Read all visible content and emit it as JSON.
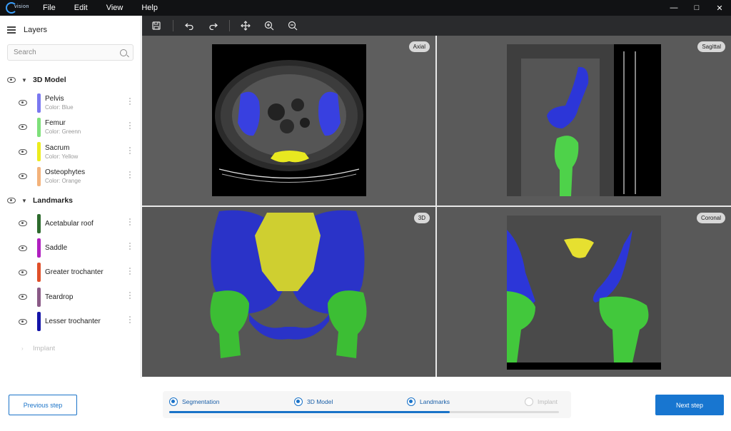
{
  "app": {
    "logo_text": "vision",
    "menu": [
      "File",
      "Edit",
      "View",
      "Help"
    ]
  },
  "sidebar": {
    "title": "Layers",
    "search_placeholder": "Search",
    "groups": [
      {
        "label": "3D Model",
        "layers": [
          {
            "name": "Pelvis",
            "sub": "Color: Blue",
            "color": "#7a78f0"
          },
          {
            "name": "Femur",
            "sub": "Color: Greenn",
            "color": "#7ee07a"
          },
          {
            "name": "Sacrum",
            "sub": "Color: Yellow",
            "color": "#ecec1e"
          },
          {
            "name": "Osteophytes",
            "sub": "Color: Orange",
            "color": "#f3b27a"
          }
        ]
      },
      {
        "label": "Landmarks",
        "layers": [
          {
            "name": "Acetabular roof",
            "color": "#2e6b2e"
          },
          {
            "name": "Saddle",
            "color": "#b01fc0"
          },
          {
            "name": "Greater trochanter",
            "color": "#e0502a"
          },
          {
            "name": "Teardrop",
            "color": "#8a5a86"
          },
          {
            "name": "Lesser trochanter",
            "color": "#1414a8"
          }
        ]
      }
    ],
    "implant_label": "Implant"
  },
  "viewports": {
    "axial": "Axial",
    "sagittal": "Sagittal",
    "three_d": "3D",
    "coronal": "Coronal"
  },
  "footer": {
    "prev_label": "Previous step",
    "next_label": "Next step",
    "steps": [
      {
        "label": "Segmentation",
        "done": true
      },
      {
        "label": "3D Model",
        "done": true
      },
      {
        "label": "Landmarks",
        "done": true
      },
      {
        "label": "Implant",
        "done": false
      }
    ],
    "progress_fraction": 0.72
  }
}
